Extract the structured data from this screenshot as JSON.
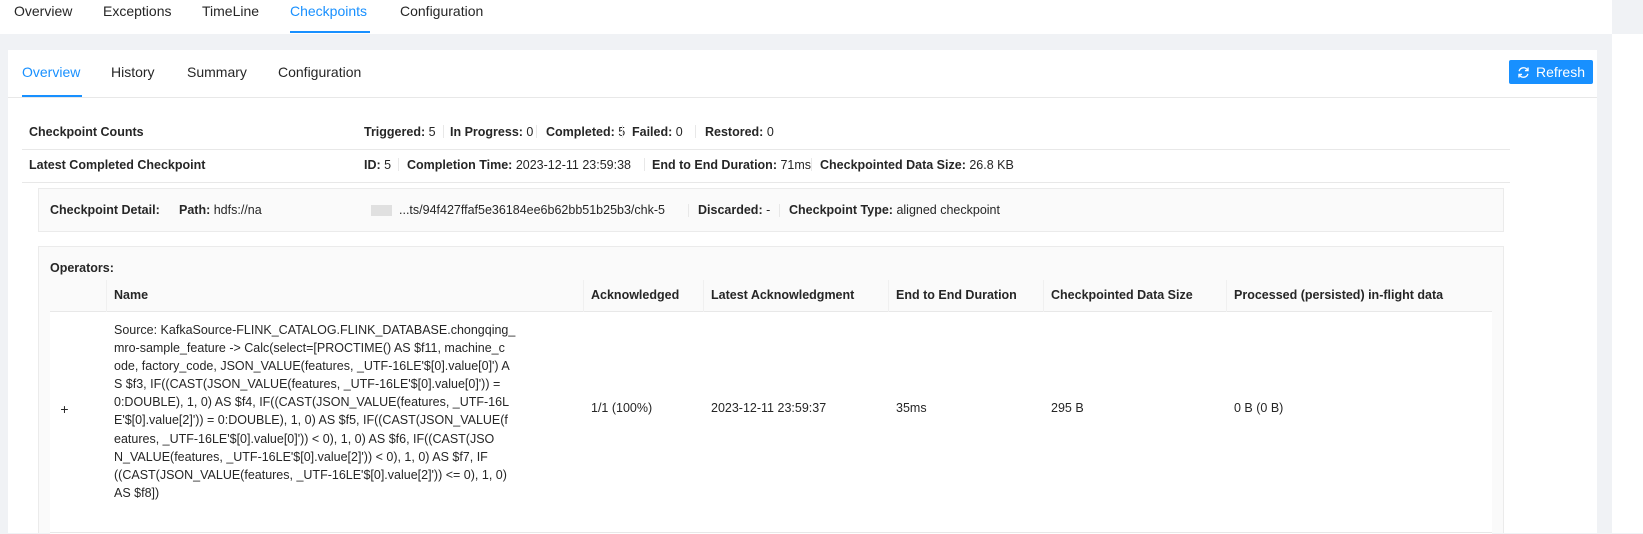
{
  "top_nav": {
    "tabs": [
      {
        "label": "Overview",
        "active": false
      },
      {
        "label": "Exceptions",
        "active": false
      },
      {
        "label": "TimeLine",
        "active": false
      },
      {
        "label": "Checkpoints",
        "active": true
      },
      {
        "label": "Configuration",
        "active": false
      }
    ]
  },
  "sub_nav": {
    "tabs": [
      {
        "label": "Overview",
        "active": true
      },
      {
        "label": "History",
        "active": false
      },
      {
        "label": "Summary",
        "active": false
      },
      {
        "label": "Configuration",
        "active": false
      }
    ],
    "refresh_label": "Refresh",
    "refresh_icon": "sync-icon"
  },
  "counts": {
    "label": "Checkpoint Counts",
    "triggered_label": "Triggered:",
    "triggered": "5",
    "in_progress_label": "In Progress:",
    "in_progress": "0",
    "completed_label": "Completed:",
    "completed": "5",
    "failed_label": "Failed:",
    "failed": "0",
    "restored_label": "Restored:",
    "restored": "0"
  },
  "latest": {
    "label": "Latest Completed Checkpoint",
    "id_label": "ID:",
    "id": "5",
    "completion_time_label": "Completion Time:",
    "completion_time": "2023-12-11 23:59:38",
    "duration_label": "End to End Duration:",
    "duration": "71ms",
    "size_label": "Checkpointed Data Size:",
    "size": "26.8 KB"
  },
  "detail": {
    "label": "Checkpoint Detail:",
    "path_label": "Path:",
    "path_prefix": "hdfs://na",
    "path_suffix": "...ts/94f427ffaf5e36184ee6b62bb51b25b3/chk-5",
    "discarded_label": "Discarded:",
    "discarded": "-",
    "type_label": "Checkpoint Type:",
    "type": "aligned checkpoint"
  },
  "operators": {
    "label": "Operators:",
    "columns": [
      "Name",
      "Acknowledged",
      "Latest Acknowledgment",
      "End to End Duration",
      "Checkpointed Data Size",
      "Processed (persisted) in-flight data"
    ],
    "rows": [
      {
        "expand_icon": "plus-icon",
        "expand_glyph": "+",
        "name": "Source: KafkaSource-FLINK_CATALOG.FLINK_DATABASE.chongqing_\nmro-sample_feature -> Calc(select=[PROCTIME() AS $f11, machine_c\node, factory_code, JSON_VALUE(features, _UTF-16LE'$[0].value[0]') A\nS $f3, IF((CAST(JSON_VALUE(features, _UTF-16LE'$[0].value[0]')) =\n0:DOUBLE), 1, 0) AS $f4, IF((CAST(JSON_VALUE(features, _UTF-16L\nE'$[0].value[2]')) = 0:DOUBLE), 1, 0) AS $f5, IF((CAST(JSON_VALUE(f\neatures, _UTF-16LE'$[0].value[0]')) < 0), 1, 0) AS $f6, IF((CAST(JSO\nN_VALUE(features, _UTF-16LE'$[0].value[2]')) < 0), 1, 0) AS $f7, IF\n((CAST(JSON_VALUE(features, _UTF-16LE'$[0].value[2]')) <= 0), 1, 0)\nAS $f8])",
        "acknowledged": "1/1 (100%)",
        "latest_ack": "2023-12-11 23:59:37",
        "duration": "35ms",
        "size": "295 B",
        "inflight": "0 B (0 B)"
      }
    ]
  },
  "colors": {
    "accent": "#1890ff",
    "page_bg": "#f0f2f5",
    "panel_bg": "#fafafa"
  }
}
